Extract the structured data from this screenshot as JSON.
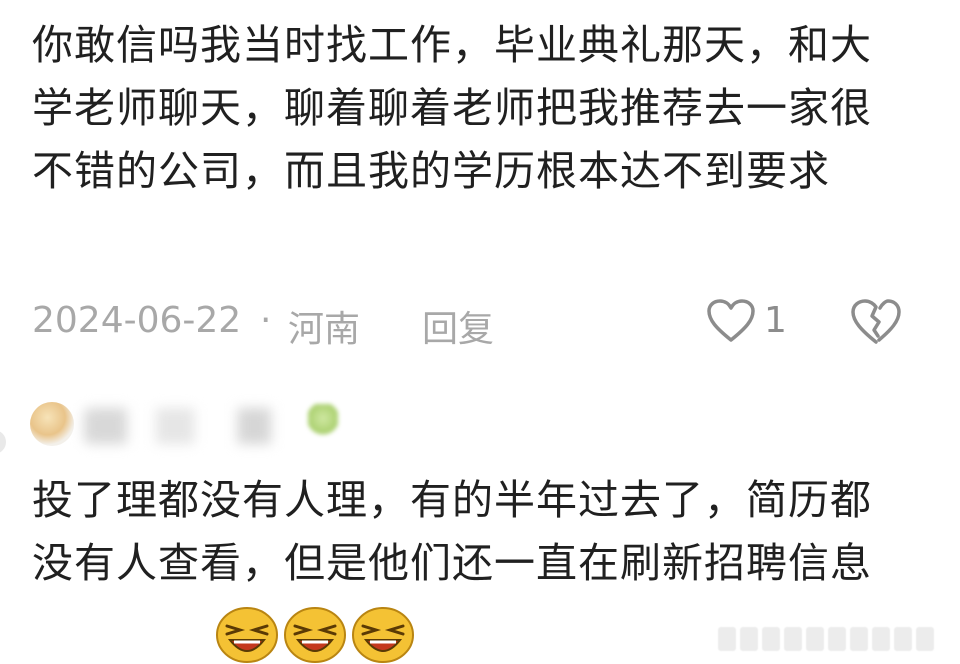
{
  "comment1": {
    "text": "你敢信吗我当时找工作，毕业典礼那天，和大学老师聊天，聊着聊着老师把我推荐去一家很不错的公司，而且我的学历根本达不到要求",
    "date": "2024-06-22",
    "separator": "·",
    "location": "河南",
    "reply_label": "回复",
    "like_count": "1"
  },
  "comment2": {
    "user": {
      "avatar_icon": "avatar-image",
      "badge_icon": "leaf-badge-icon"
    },
    "text": "投了理都没有人理，有的半年过去了，简历都没有人查看，但是他们还一直在刷新招聘信息",
    "emoji_icons": [
      "laughing-emoji-icon",
      "laughing-emoji-icon",
      "laughing-emoji-icon"
    ]
  },
  "colors": {
    "text": "#202020",
    "meta": "#a8a8a8",
    "icon": "#8c8c8c",
    "emoji_face": "#f4c234",
    "emoji_mouth": "#c4391e"
  }
}
